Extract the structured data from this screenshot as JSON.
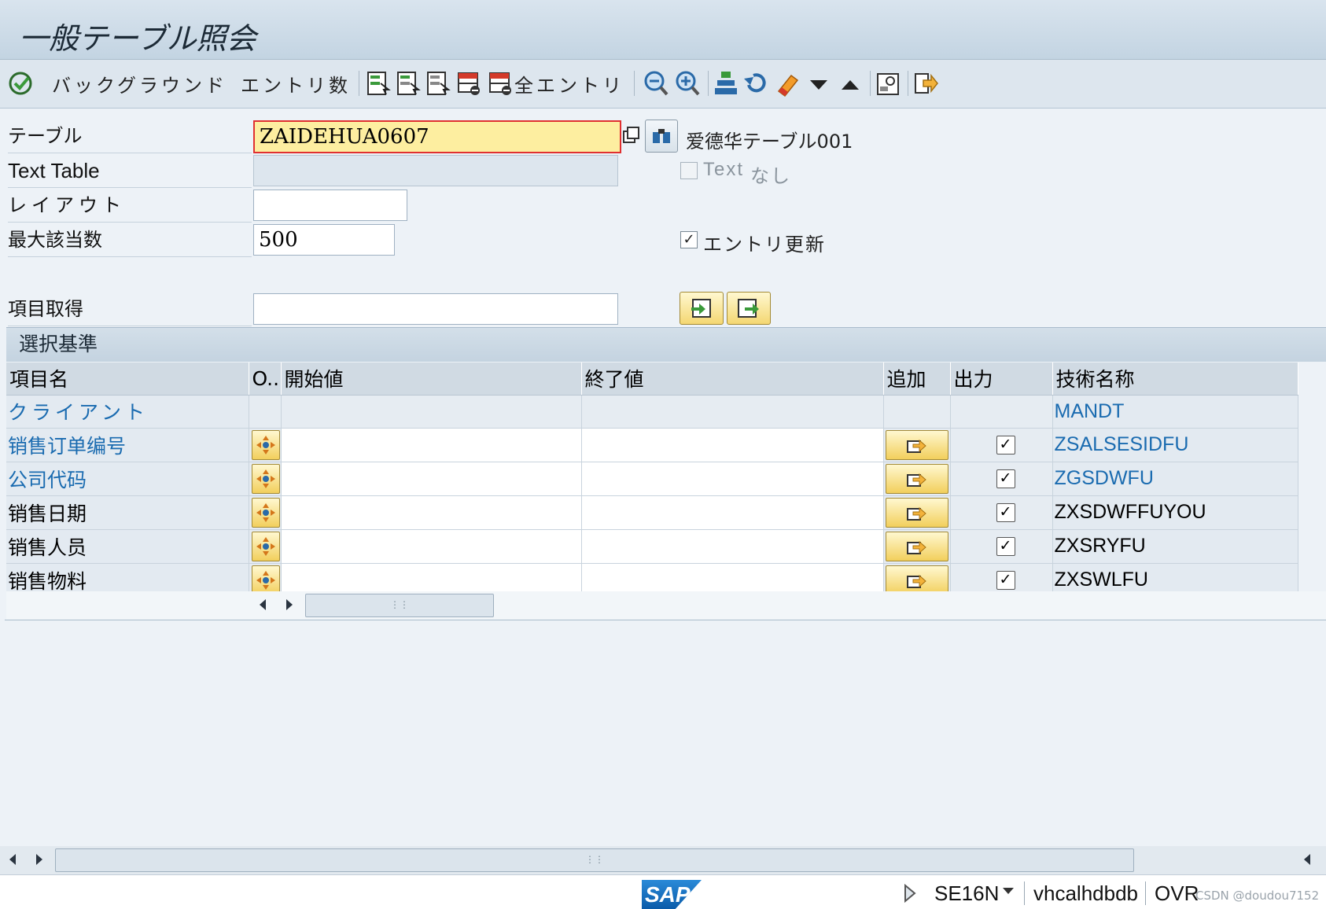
{
  "window": {
    "title": "一般テーブル照会"
  },
  "toolbar": {
    "background_label": "バックグラウンド",
    "entry_count_label": "エントリ数",
    "all_entries_label": "全エントリ"
  },
  "form": {
    "table": {
      "label": "テーブル",
      "value": "ZAIDEHUA0607",
      "description": "爱德华テーブル001"
    },
    "text_table": {
      "label": "Text Table",
      "value": "",
      "checkbox_label_1": "Text",
      "checkbox_label_2": "なし",
      "checked": false
    },
    "layout": {
      "label": "レイアウト",
      "value": ""
    },
    "max_hits": {
      "label": "最大該当数",
      "value": "500"
    },
    "entry_update": {
      "label": "エントリ更新",
      "checked": true,
      "mark": "✓"
    },
    "field_get": {
      "label": "項目取得",
      "value": ""
    }
  },
  "selection": {
    "title": "選択基準",
    "columns": [
      "項目名",
      "O..",
      "開始値",
      "終了値",
      "追加",
      "出力",
      "技術名称"
    ],
    "rows": [
      {
        "name": "クライアント",
        "tech": "MANDT",
        "link": true,
        "has_controls": false
      },
      {
        "name": "销售订单编号",
        "tech": "ZSALSESIDFU",
        "link": true,
        "has_controls": true,
        "output": "✓"
      },
      {
        "name": "公司代码",
        "tech": "ZGSDWFU",
        "link": true,
        "has_controls": true,
        "output": "✓"
      },
      {
        "name": "销售日期",
        "tech": "ZXSDWFFUYOU",
        "link": false,
        "has_controls": true,
        "output": "✓"
      },
      {
        "name": "销售人员",
        "tech": "ZXSRYFU",
        "link": false,
        "has_controls": true,
        "output": "✓"
      },
      {
        "name": "销售物料",
        "tech": "ZXSWLFU",
        "link": false,
        "has_controls": true,
        "output": "✓"
      }
    ]
  },
  "statusbar": {
    "logo": "SAP",
    "transaction": "SE16N",
    "system": "vhcalhdbdb",
    "mode": "OVR"
  },
  "watermark": "CSDN @doudou7152",
  "colors": {
    "link": "#1a6bb0",
    "focus_field": "#fdeea0",
    "button": "#f2cf5c"
  }
}
